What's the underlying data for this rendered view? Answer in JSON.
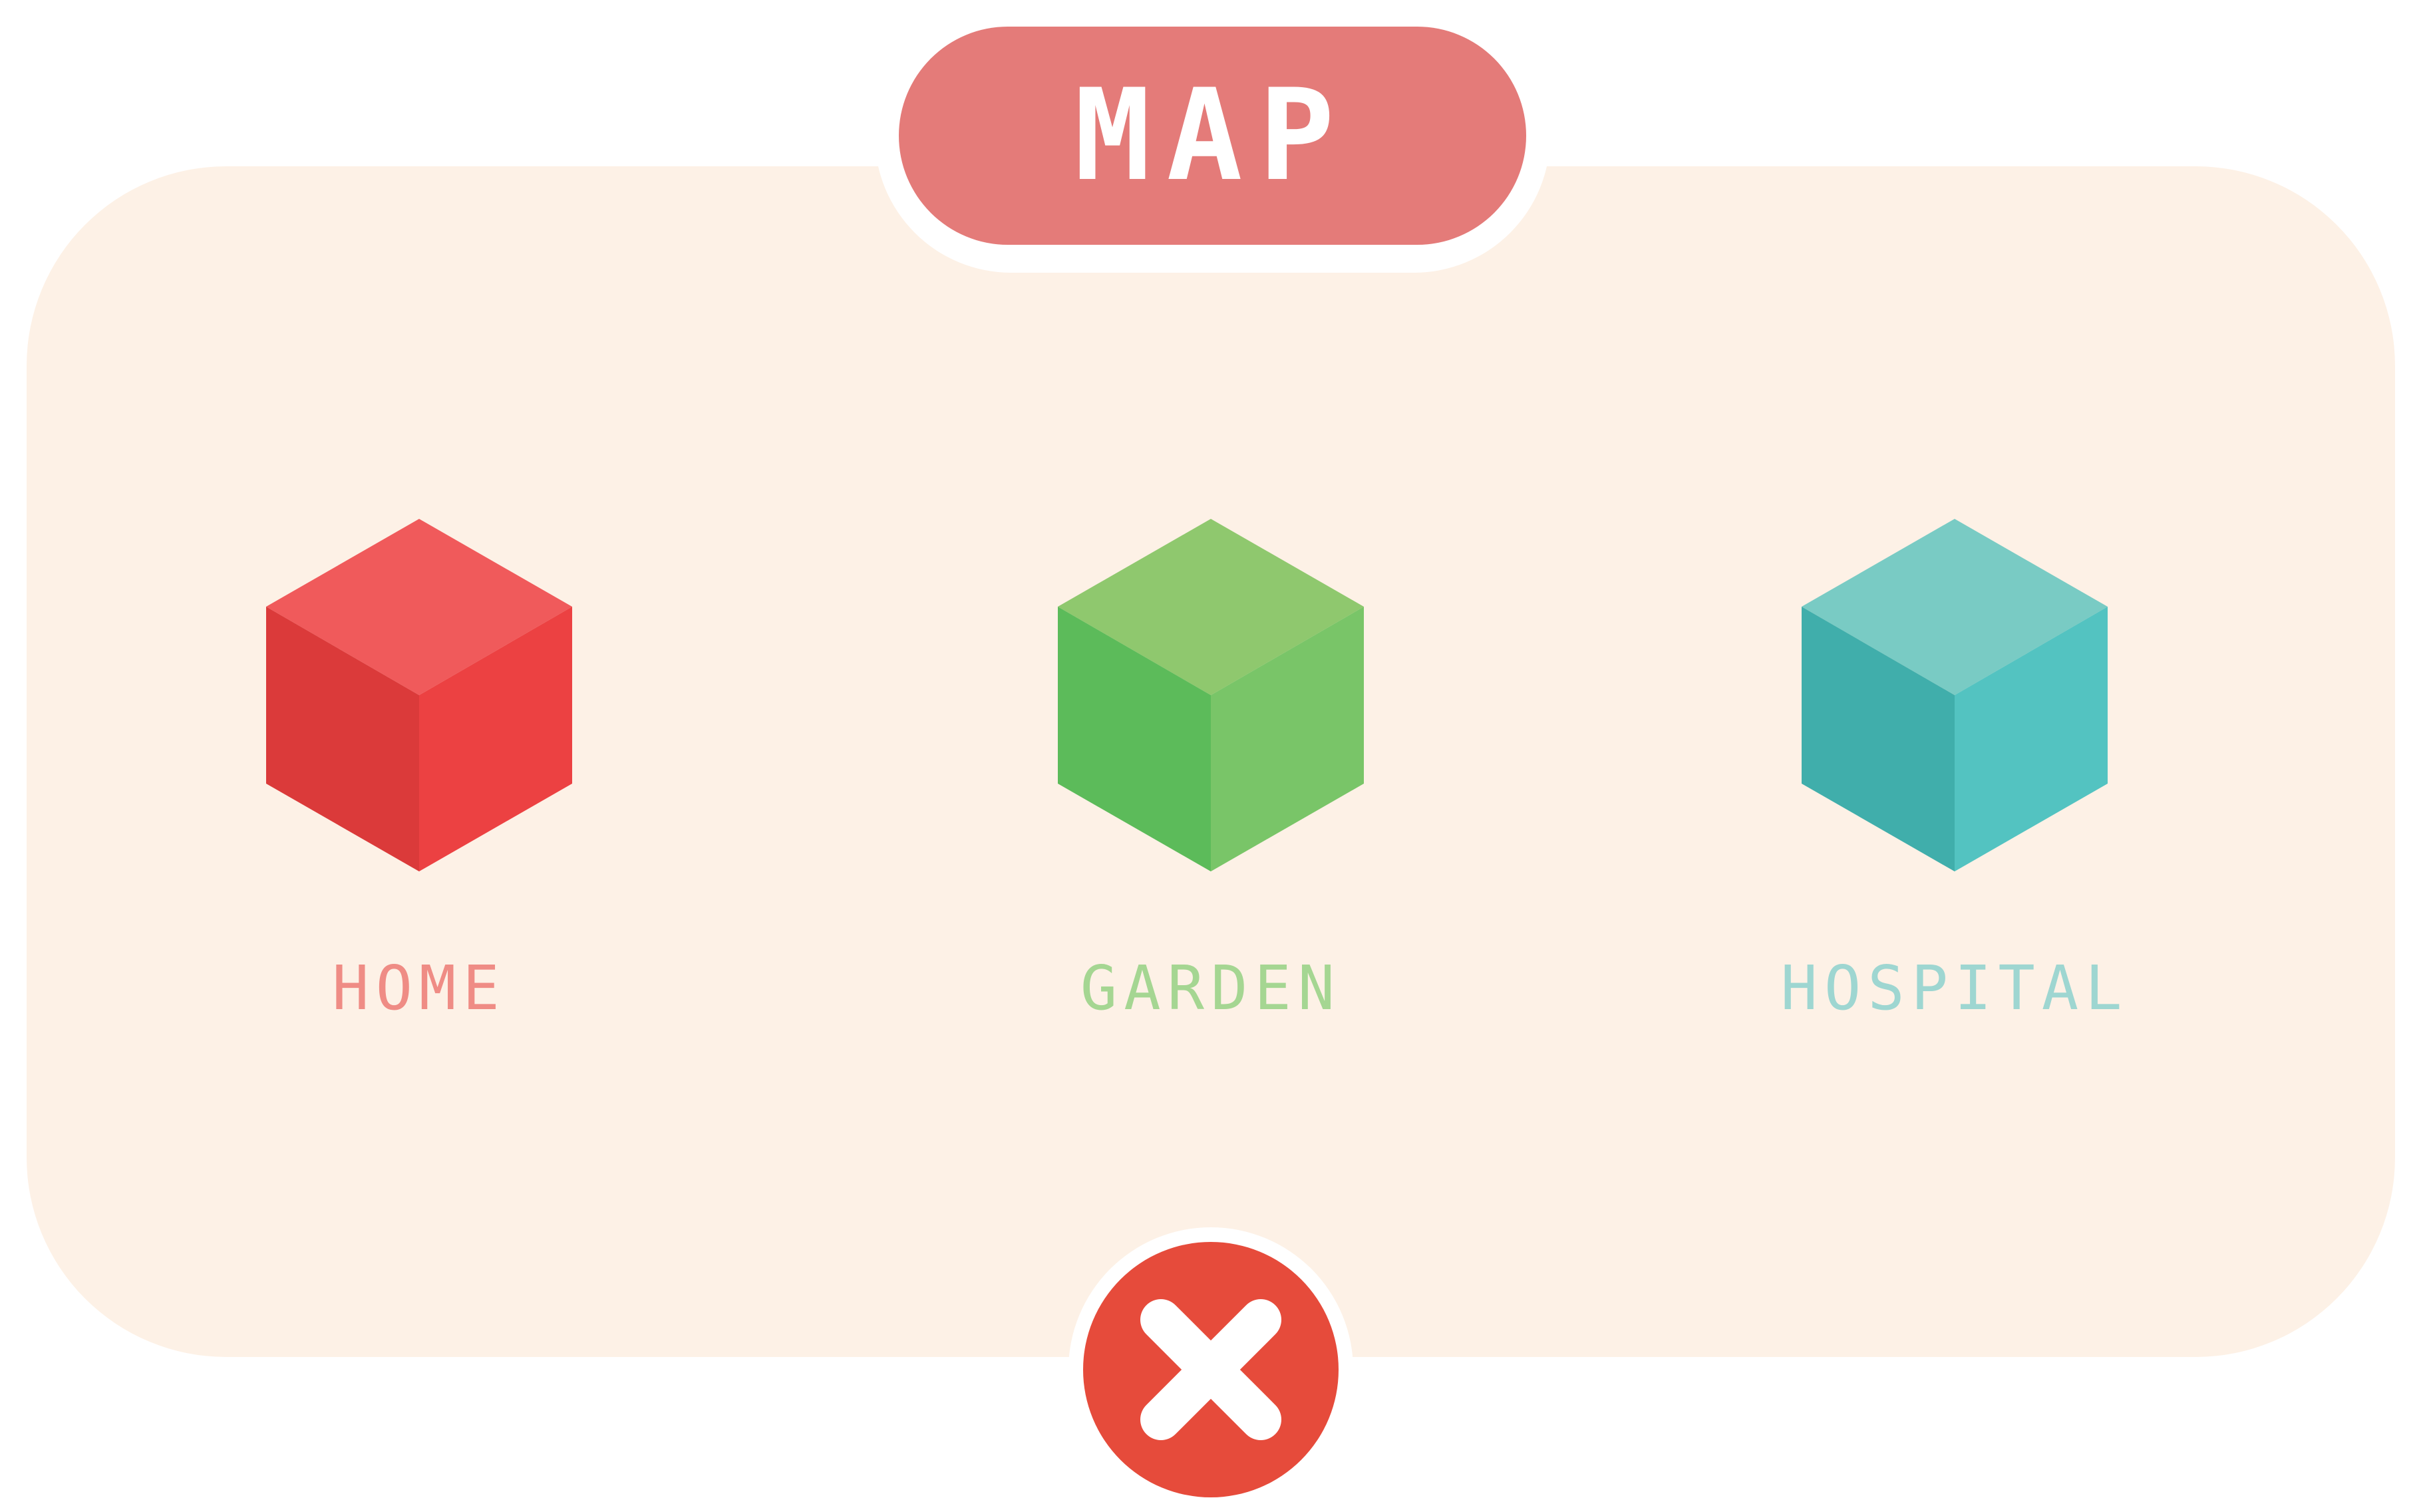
{
  "title": "MAP",
  "locations": [
    {
      "label": "HOME",
      "label_color": "#ef8c85",
      "icon": "red-cube-icon",
      "colors": {
        "top": "#f05a5b",
        "left": "#db3a3a",
        "right": "#ec4142"
      }
    },
    {
      "label": "GARDEN",
      "label_color": "#a5d692",
      "icon": "green-cube-icon",
      "colors": {
        "top": "#8fc86e",
        "left": "#5cbb5a",
        "right": "#79c568"
      }
    },
    {
      "label": "HOSPITAL",
      "label_color": "#9ed6d1",
      "icon": "teal-cube-icon",
      "colors": {
        "top": "#79cbc4",
        "left": "#40aeab",
        "right": "#53c3c1"
      }
    }
  ],
  "close_button": {
    "icon": "close-icon",
    "color": "#e64b3b"
  }
}
